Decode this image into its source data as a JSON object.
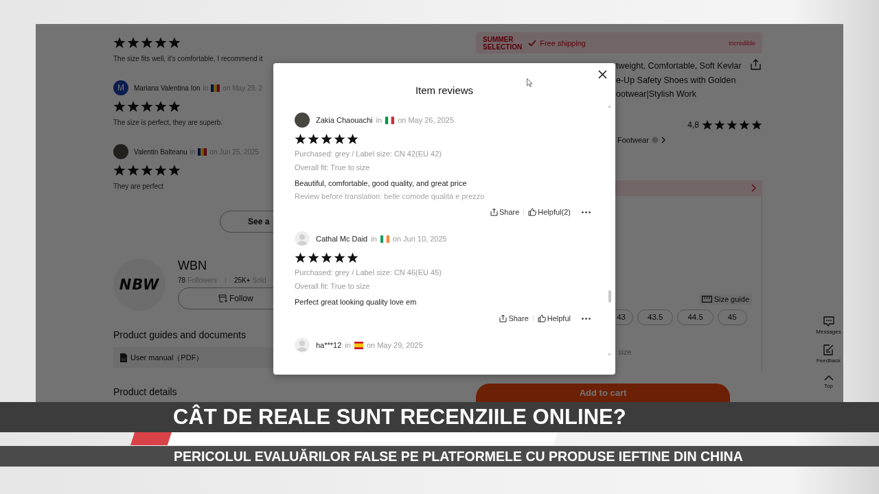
{
  "page": {
    "reviews": [
      {
        "stars": 5,
        "text": "The size fits well, it's comfortable, I recommend it"
      },
      {
        "avatar": {
          "kind": "letter",
          "letter": "M"
        },
        "name": "Mariana Valentina Ion",
        "in": "in",
        "flag": {
          "kind": "ro"
        },
        "date": "on May 29, 2",
        "stars": 5,
        "text": "The size is perfect, they are superb."
      },
      {
        "avatar": {
          "kind": "photo"
        },
        "name": "Valentin Balteanu",
        "in": "in",
        "flag": {
          "kind": "ro"
        },
        "date": "on Jun 25, 2025",
        "stars": 5,
        "text": "They are perfect"
      }
    ],
    "see_all": "See a",
    "store": {
      "logo": "NBW",
      "name": "WBN",
      "followers_count": "78",
      "followers_label": "Followers",
      "sold_count": "25K+",
      "sold_label": "Sold",
      "follow": "Follow"
    },
    "guides": {
      "title": "Product guides and documents",
      "file": "User manual（PDF）"
    },
    "details_title": "Product details",
    "promo": {
      "logo_lines": [
        "SUMMER",
        "SELECTION"
      ],
      "shipping": "Free shipping",
      "tag": "Incredible"
    },
    "title_lines": [
      "tweight, Comfortable, Soft Kevlar",
      "e-Up Safety Shoes with Golden",
      "ootwear|Stylish Work"
    ],
    "rating": {
      "value": "4,8",
      "stars": 5
    },
    "store_link": "Footwear",
    "size_guide": "Size guide",
    "sizes": [
      "43",
      "43.5",
      "44.5",
      "45"
    ],
    "fit_fragment": "size",
    "add_to_cart": "Add to cart",
    "side_widget": [
      {
        "kind": "messages",
        "label": "Messages"
      },
      {
        "kind": "feedback",
        "label": "Feedback"
      },
      {
        "kind": "top",
        "label": "Top"
      }
    ]
  },
  "modal": {
    "title": "Item reviews",
    "reviews": [
      {
        "avatar": {
          "kind": "photo"
        },
        "name": "Zakia Chaouachi",
        "in": "in",
        "flag": {
          "kind": "it"
        },
        "date": "on May 26, 2025",
        "stars": 5,
        "purchased": "Purchased: grey / Label size: CN 42(EU 42)",
        "fit": "Overall fit: True to size",
        "text": "Beautiful, comfortable, good quality, and great price",
        "original": "Review before translation: belle comode qualità e prezzo",
        "share": "Share",
        "helpful": "Helpful(2)"
      },
      {
        "avatar": {
          "kind": "default"
        },
        "name": "Cathal Mc Daid",
        "in": "in",
        "flag": {
          "kind": "ie"
        },
        "date": "on Jun 10, 2025",
        "stars": 5,
        "purchased": "Purchased: grey / Label size: CN 46(EU 45)",
        "fit": "Overall fit: True to size",
        "text": "Perfect great looking quality love em",
        "share": "Share",
        "helpful": "Helpful"
      },
      {
        "avatar": {
          "kind": "default"
        },
        "name": "ha***12",
        "in": "in",
        "flag": {
          "kind": "es"
        },
        "date": "on May 29, 2025"
      }
    ]
  },
  "caption": {
    "headline": "CÂT DE REALE SUNT RECENZIILE ONLINE?",
    "subline": "PERICOLUL EVALUĂRILOR FALSE PE PLATFORMELE CU PRODUSE IEFTINE DIN CHINA"
  }
}
